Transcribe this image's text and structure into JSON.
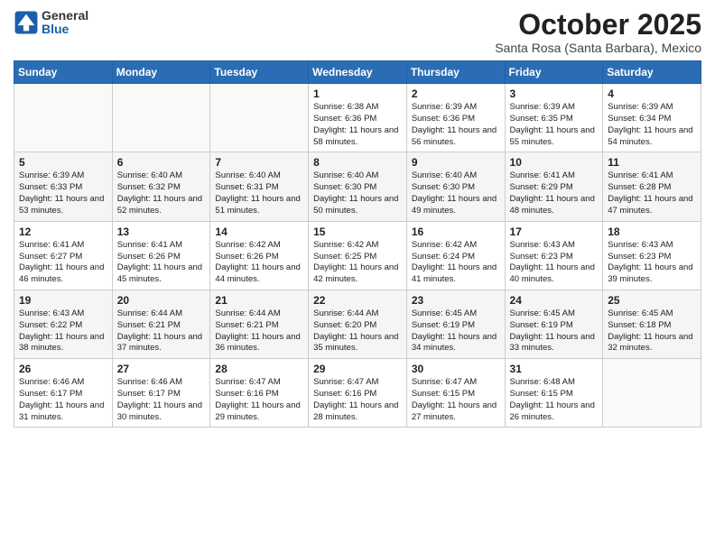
{
  "header": {
    "logo_general": "General",
    "logo_blue": "Blue",
    "month": "October 2025",
    "location": "Santa Rosa (Santa Barbara), Mexico"
  },
  "weekdays": [
    "Sunday",
    "Monday",
    "Tuesday",
    "Wednesday",
    "Thursday",
    "Friday",
    "Saturday"
  ],
  "weeks": [
    [
      {
        "num": "",
        "info": ""
      },
      {
        "num": "",
        "info": ""
      },
      {
        "num": "",
        "info": ""
      },
      {
        "num": "1",
        "info": "Sunrise: 6:38 AM\nSunset: 6:36 PM\nDaylight: 11 hours\nand 58 minutes."
      },
      {
        "num": "2",
        "info": "Sunrise: 6:39 AM\nSunset: 6:36 PM\nDaylight: 11 hours\nand 56 minutes."
      },
      {
        "num": "3",
        "info": "Sunrise: 6:39 AM\nSunset: 6:35 PM\nDaylight: 11 hours\nand 55 minutes."
      },
      {
        "num": "4",
        "info": "Sunrise: 6:39 AM\nSunset: 6:34 PM\nDaylight: 11 hours\nand 54 minutes."
      }
    ],
    [
      {
        "num": "5",
        "info": "Sunrise: 6:39 AM\nSunset: 6:33 PM\nDaylight: 11 hours\nand 53 minutes."
      },
      {
        "num": "6",
        "info": "Sunrise: 6:40 AM\nSunset: 6:32 PM\nDaylight: 11 hours\nand 52 minutes."
      },
      {
        "num": "7",
        "info": "Sunrise: 6:40 AM\nSunset: 6:31 PM\nDaylight: 11 hours\nand 51 minutes."
      },
      {
        "num": "8",
        "info": "Sunrise: 6:40 AM\nSunset: 6:30 PM\nDaylight: 11 hours\nand 50 minutes."
      },
      {
        "num": "9",
        "info": "Sunrise: 6:40 AM\nSunset: 6:30 PM\nDaylight: 11 hours\nand 49 minutes."
      },
      {
        "num": "10",
        "info": "Sunrise: 6:41 AM\nSunset: 6:29 PM\nDaylight: 11 hours\nand 48 minutes."
      },
      {
        "num": "11",
        "info": "Sunrise: 6:41 AM\nSunset: 6:28 PM\nDaylight: 11 hours\nand 47 minutes."
      }
    ],
    [
      {
        "num": "12",
        "info": "Sunrise: 6:41 AM\nSunset: 6:27 PM\nDaylight: 11 hours\nand 46 minutes."
      },
      {
        "num": "13",
        "info": "Sunrise: 6:41 AM\nSunset: 6:26 PM\nDaylight: 11 hours\nand 45 minutes."
      },
      {
        "num": "14",
        "info": "Sunrise: 6:42 AM\nSunset: 6:26 PM\nDaylight: 11 hours\nand 44 minutes."
      },
      {
        "num": "15",
        "info": "Sunrise: 6:42 AM\nSunset: 6:25 PM\nDaylight: 11 hours\nand 42 minutes."
      },
      {
        "num": "16",
        "info": "Sunrise: 6:42 AM\nSunset: 6:24 PM\nDaylight: 11 hours\nand 41 minutes."
      },
      {
        "num": "17",
        "info": "Sunrise: 6:43 AM\nSunset: 6:23 PM\nDaylight: 11 hours\nand 40 minutes."
      },
      {
        "num": "18",
        "info": "Sunrise: 6:43 AM\nSunset: 6:23 PM\nDaylight: 11 hours\nand 39 minutes."
      }
    ],
    [
      {
        "num": "19",
        "info": "Sunrise: 6:43 AM\nSunset: 6:22 PM\nDaylight: 11 hours\nand 38 minutes."
      },
      {
        "num": "20",
        "info": "Sunrise: 6:44 AM\nSunset: 6:21 PM\nDaylight: 11 hours\nand 37 minutes."
      },
      {
        "num": "21",
        "info": "Sunrise: 6:44 AM\nSunset: 6:21 PM\nDaylight: 11 hours\nand 36 minutes."
      },
      {
        "num": "22",
        "info": "Sunrise: 6:44 AM\nSunset: 6:20 PM\nDaylight: 11 hours\nand 35 minutes."
      },
      {
        "num": "23",
        "info": "Sunrise: 6:45 AM\nSunset: 6:19 PM\nDaylight: 11 hours\nand 34 minutes."
      },
      {
        "num": "24",
        "info": "Sunrise: 6:45 AM\nSunset: 6:19 PM\nDaylight: 11 hours\nand 33 minutes."
      },
      {
        "num": "25",
        "info": "Sunrise: 6:45 AM\nSunset: 6:18 PM\nDaylight: 11 hours\nand 32 minutes."
      }
    ],
    [
      {
        "num": "26",
        "info": "Sunrise: 6:46 AM\nSunset: 6:17 PM\nDaylight: 11 hours\nand 31 minutes."
      },
      {
        "num": "27",
        "info": "Sunrise: 6:46 AM\nSunset: 6:17 PM\nDaylight: 11 hours\nand 30 minutes."
      },
      {
        "num": "28",
        "info": "Sunrise: 6:47 AM\nSunset: 6:16 PM\nDaylight: 11 hours\nand 29 minutes."
      },
      {
        "num": "29",
        "info": "Sunrise: 6:47 AM\nSunset: 6:16 PM\nDaylight: 11 hours\nand 28 minutes."
      },
      {
        "num": "30",
        "info": "Sunrise: 6:47 AM\nSunset: 6:15 PM\nDaylight: 11 hours\nand 27 minutes."
      },
      {
        "num": "31",
        "info": "Sunrise: 6:48 AM\nSunset: 6:15 PM\nDaylight: 11 hours\nand 26 minutes."
      },
      {
        "num": "",
        "info": ""
      }
    ]
  ]
}
